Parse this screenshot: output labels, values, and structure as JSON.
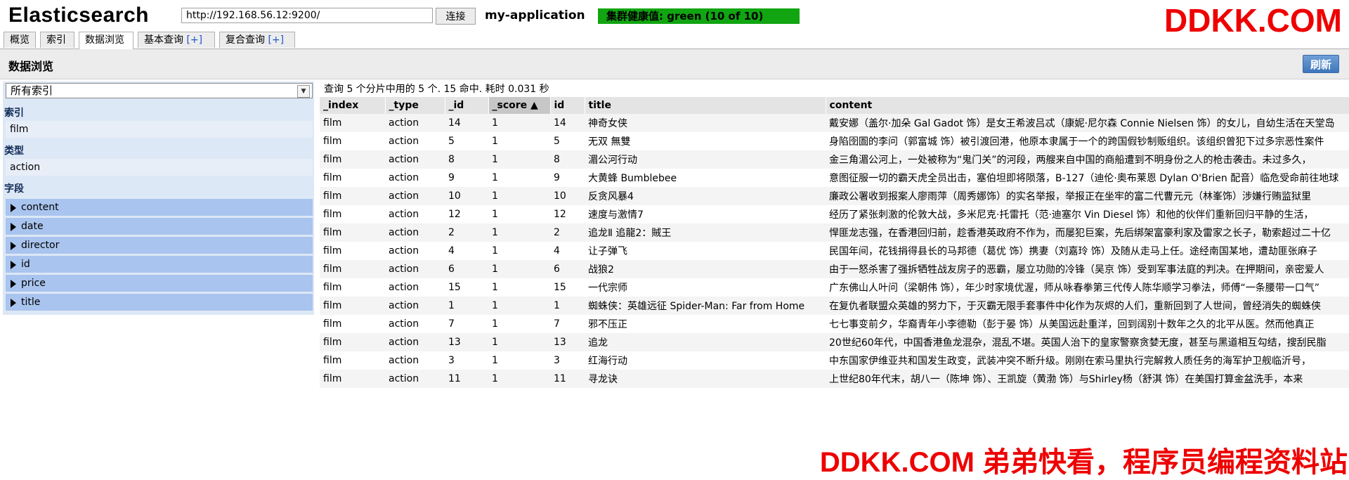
{
  "header": {
    "logo": "Elasticsearch",
    "url": "http://192.168.56.12:9200/",
    "connect_label": "连接",
    "cluster_name": "my-application",
    "health_text": "集群健康值: green (10 of 10)",
    "health_color": "#11a511"
  },
  "watermark_top": "DDKK.COM",
  "watermark_bottom": "DDKK.COM 弟弟快看，程序员编程资料站",
  "tabs": [
    {
      "label": "概览"
    },
    {
      "label": "索引"
    },
    {
      "label": "数据浏览"
    },
    {
      "label": "基本查询",
      "plus": "[+]"
    },
    {
      "label": "复合查询",
      "plus": "[+]"
    }
  ],
  "page": {
    "title": "数据浏览",
    "refresh_label": "刷新"
  },
  "sidebar": {
    "index_select": "所有索引",
    "sections": {
      "index": {
        "label": "索引",
        "item": "film"
      },
      "type": {
        "label": "类型",
        "item": "action"
      },
      "fields": {
        "label": "字段",
        "items": [
          "content",
          "date",
          "director",
          "id",
          "price",
          "title"
        ]
      }
    }
  },
  "query_info": "查询 5 个分片中用的 5 个. 15 命中. 耗时 0.031 秒",
  "table": {
    "columns": [
      "_index",
      "_type",
      "_id",
      "_score ▲",
      "id",
      "title",
      "content"
    ],
    "rows": [
      [
        "film",
        "action",
        "14",
        "1",
        "14",
        "神奇女侠",
        "戴安娜（盖尔·加朵 Gal Gadot 饰）是女王希波吕忒（康妮·尼尔森 Connie Nielsen 饰）的女儿，自幼生活在天堂岛"
      ],
      [
        "film",
        "action",
        "5",
        "1",
        "5",
        "无双 無雙",
        "身陷囹圄的李问（郭富城 饰）被引渡回港，他原本隶属于一个的跨国假钞制贩组织。该组织曾犯下过多宗恶性案件"
      ],
      [
        "film",
        "action",
        "8",
        "1",
        "8",
        "湄公河行动",
        "金三角湄公河上，一处被称为“鬼门关”的河段，两艘来自中国的商船遭到不明身份之人的枪击袭击。未过多久，"
      ],
      [
        "film",
        "action",
        "9",
        "1",
        "9",
        "大黄蜂 Bumblebee",
        "意图征服一切的霸天虎全员出击，塞伯坦即将陨落，B-127（迪伦·奥布莱恩 Dylan O'Brien 配音）临危受命前往地球"
      ],
      [
        "film",
        "action",
        "10",
        "1",
        "10",
        "反贪风暴4",
        "廉政公署收到报案人廖雨萍（周秀娜饰）的实名举报，举报正在坐牢的富二代曹元元（林峯饰）涉嫌行贿监狱里"
      ],
      [
        "film",
        "action",
        "12",
        "1",
        "12",
        "速度与激情7",
        "经历了紧张刺激的伦敦大战，多米尼克·托雷托（范·迪塞尔 Vin Diesel 饰）和他的伙伴们重新回归平静的生活，"
      ],
      [
        "film",
        "action",
        "2",
        "1",
        "2",
        "追龙Ⅱ 追龍2：賊王",
        "悍匪龙志强，在香港回归前，趁香港英政府不作为，而屡犯巨案，先后绑架富豪利家及雷家之长子，勒索超过二十亿"
      ],
      [
        "film",
        "action",
        "4",
        "1",
        "4",
        "让子弹飞",
        "民国年间，花钱捐得县长的马邦德（葛优 饰）携妻（刘嘉玲 饰）及随从走马上任。途经南国某地，遭劫匪张麻子"
      ],
      [
        "film",
        "action",
        "6",
        "1",
        "6",
        "战狼2",
        "由于一怒杀害了强拆牺牲战友房子的恶霸，屡立功勋的冷锋（吴京 饰）受到军事法庭的判决。在押期间，亲密爱人"
      ],
      [
        "film",
        "action",
        "15",
        "1",
        "15",
        "一代宗师",
        "广东佛山人叶问（梁朝伟 饰），年少时家境优渥，师从咏春拳第三代传人陈华顺学习拳法，师傅“一条腰带一口气”"
      ],
      [
        "film",
        "action",
        "1",
        "1",
        "1",
        "蜘蛛侠：英雄远征 Spider-Man: Far from Home",
        "在复仇者联盟众英雄的努力下，于灭霸无限手套事件中化作为灰烬的人们，重新回到了人世间，曾经消失的蜘蛛侠"
      ],
      [
        "film",
        "action",
        "7",
        "1",
        "7",
        "邪不压正",
        "七七事变前夕，华裔青年小李德勒（彭于晏 饰）从美国远赴重洋，回到阔别十数年之久的北平从医。然而他真正"
      ],
      [
        "film",
        "action",
        "13",
        "1",
        "13",
        "追龙",
        "20世纪60年代，中国香港鱼龙混杂，混乱不堪。英国人治下的皇家警察贪婪无度，甚至与黑道相互勾结，搜刮民脂"
      ],
      [
        "film",
        "action",
        "3",
        "1",
        "3",
        "红海行动",
        "中东国家伊维亚共和国发生政变，武装冲突不断升级。刚刚在索马里执行完解救人质任务的海军护卫舰临沂号，"
      ],
      [
        "film",
        "action",
        "11",
        "1",
        "11",
        "寻龙诀",
        "上世纪80年代末，胡八一（陈坤 饰）、王凯旋（黄渤 饰）与Shirley杨（舒淇 饰）在美国打算金盆洗手，本来"
      ]
    ]
  }
}
